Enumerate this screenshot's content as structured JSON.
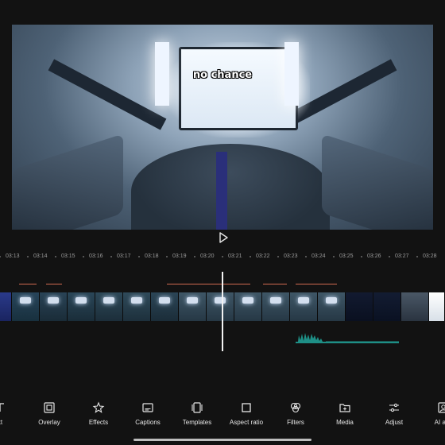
{
  "preview": {
    "caption": "no chance"
  },
  "player": {
    "play_icon": "play-icon"
  },
  "ruler": {
    "ticks": [
      "03:13",
      "03:14",
      "03:15",
      "03:16",
      "03:17",
      "03:18",
      "03:19",
      "03:20",
      "03:21",
      "03:22",
      "03:23",
      "03:24",
      "03:25",
      "03:26",
      "03:27",
      "03:28"
    ]
  },
  "toolbar": {
    "items": [
      {
        "label": "xt",
        "icon": "text-icon"
      },
      {
        "label": "Overlay",
        "icon": "overlay-icon"
      },
      {
        "label": "Effects",
        "icon": "effects-icon"
      },
      {
        "label": "Captions",
        "icon": "captions-icon"
      },
      {
        "label": "Templates",
        "icon": "templates-icon"
      },
      {
        "label": "Aspect ratio",
        "icon": "aspect-ratio-icon"
      },
      {
        "label": "Filters",
        "icon": "filters-icon"
      },
      {
        "label": "Media",
        "icon": "media-icon"
      },
      {
        "label": "Adjust",
        "icon": "adjust-icon"
      },
      {
        "label": "AI ava",
        "icon": "ai-avatar-icon"
      }
    ]
  },
  "colors": {
    "background": "#121212",
    "accent_marker": "#d06a50",
    "audio_wave": "#1e8f86",
    "playhead": "#f2f2f2"
  }
}
